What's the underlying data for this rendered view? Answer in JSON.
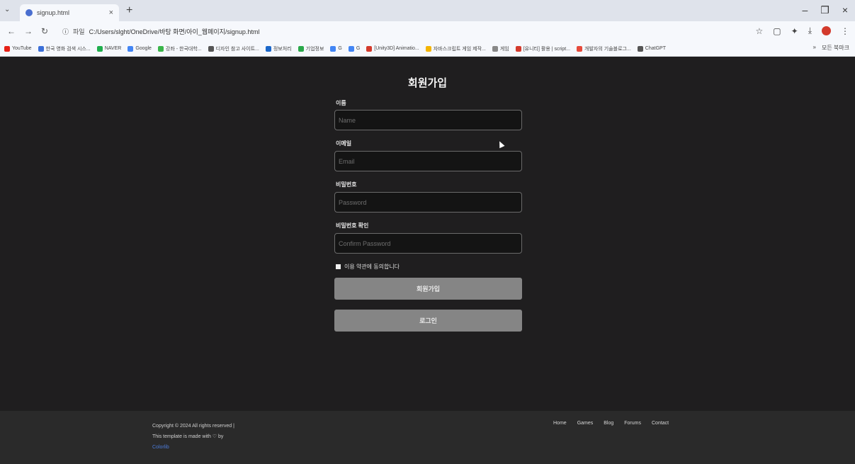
{
  "browser": {
    "tab_title": "signup.html",
    "url_label": "파일",
    "url": "C:/Users/slght/OneDrive/바탕 화면/아이_웹페이지/signup.html",
    "bookmarks": [
      {
        "label": "YouTube",
        "color": "#e62117"
      },
      {
        "label": "한국 영화 검색 시스...",
        "color": "#3b6fd8"
      },
      {
        "label": "NAVER",
        "color": "#1fae4d"
      },
      {
        "label": "Google",
        "color": "#4285f4"
      },
      {
        "label": "강좌 - 한국대학...",
        "color": "#3ab54a"
      },
      {
        "label": "디자인 참고 사이트...",
        "color": "#555555"
      },
      {
        "label": "정보처리",
        "color": "#1b67c9"
      },
      {
        "label": "기업정보",
        "color": "#2aa84a"
      },
      {
        "label": "G",
        "color": "#4285f4"
      },
      {
        "label": "G",
        "color": "#4285f4"
      },
      {
        "label": "[Unity3D] Animatio...",
        "color": "#d33a2c"
      },
      {
        "label": "자바스크립트 게임 제작...",
        "color": "#f4b400"
      },
      {
        "label": "게임",
        "color": "#888888"
      },
      {
        "label": "[유니티] 활용 | script...",
        "color": "#d33a2c"
      },
      {
        "label": "개발자의 기술블로그...",
        "color": "#e64a3b"
      },
      {
        "label": "ChatGPT",
        "color": "#555555"
      }
    ],
    "all_bookmarks": "모든 북마크"
  },
  "form": {
    "title": "회원가입",
    "name_label": "이름",
    "name_placeholder": "Name",
    "email_label": "이메일",
    "email_placeholder": "Email",
    "password_label": "비밀번호",
    "password_placeholder": "Password",
    "confirm_label": "비밀번호 확인",
    "confirm_placeholder": "Confirm Password",
    "agree_label": "이용 약관에 동의합니다",
    "signup_button": "회원가입",
    "login_button": "로그인"
  },
  "footer": {
    "copyright": "Copyright © 2024 All rights reserved | This template is made with ♡ by",
    "brand": "Colorlib",
    "links": [
      "Home",
      "Games",
      "Blog",
      "Forums",
      "Contact"
    ]
  }
}
